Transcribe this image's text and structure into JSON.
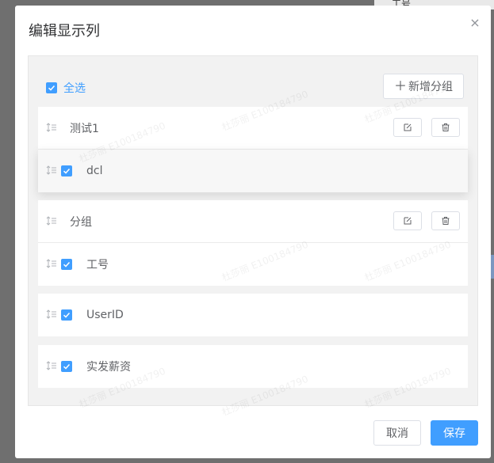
{
  "background": {
    "peek_text": "工号"
  },
  "dialog": {
    "title": "编辑显示列",
    "close_glyph": "×",
    "select_all_label": "全选",
    "add_group_label": "新增分组",
    "add_group_glyph": "＋",
    "groups": [
      {
        "name": "测试1",
        "fields": [
          {
            "name": "dcl",
            "checked": true
          }
        ]
      },
      {
        "name": "分组",
        "fields": [
          {
            "name": "工号",
            "checked": true
          }
        ]
      }
    ],
    "standalone_fields": [
      {
        "name": "UserID",
        "checked": true
      },
      {
        "name": "实发薪资",
        "checked": true
      }
    ],
    "cancel_label": "取消",
    "save_label": "保存"
  },
  "watermark": "杜莎丽 E100184790",
  "colors": {
    "accent": "#409eff",
    "panel_bg": "#f2f2f2",
    "text": "#606266",
    "title": "#303133"
  }
}
